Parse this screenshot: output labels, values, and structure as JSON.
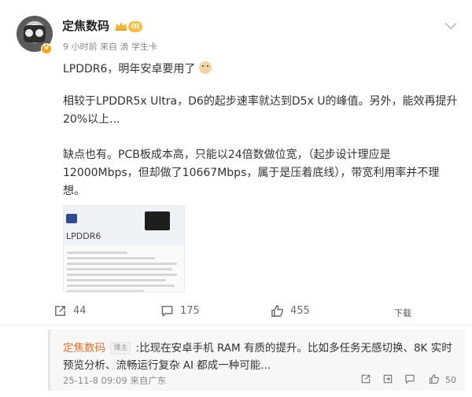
{
  "post": {
    "username": "定焦数码",
    "level": "III",
    "meta": "9 小时前  来自 滴 学生卡",
    "paragraph1": "LPDDR6，明年安卓要用了",
    "paragraph2": "相较于LPDDR5x Ultra，D6的起步速率就达到D5x U的峰值。另外，能效再提升20%以上...",
    "paragraph3": "缺点也有。PCB板成本高，只能以24倍数做位宽，（起步设计理应是12000Mbps，但却做了10667Mbps，属于是压着底线），带宽利用率并不理想。",
    "image_label": "LPDDR6"
  },
  "actions": {
    "share_count": "44",
    "comment_count": "175",
    "like_count": "455",
    "download_label": "下载"
  },
  "comment": {
    "user": "定焦数码",
    "author_tag": "博主",
    "text": ":比现在安卓手机 RAM 有质的提升。比如多任务无感切换、8K 实时预览分析、流畅运行复杂 AI 都成一种可能...",
    "time": "25-11-8 09:09  来自广东",
    "like_count": "50"
  },
  "colors": {
    "accent": "#e2722a",
    "badge": "#f6c044"
  }
}
